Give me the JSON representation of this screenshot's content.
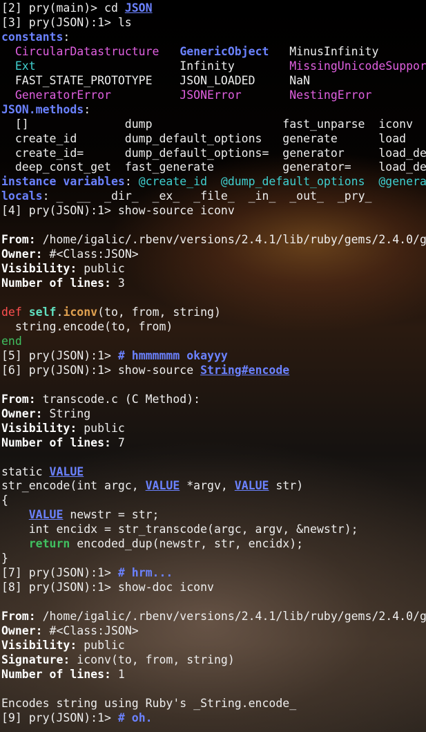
{
  "lines": [
    {
      "segs": [
        {
          "t": "[2] pry(main)> cd ",
          "cls": "c-norm"
        },
        {
          "t": "JSON",
          "cls": "c-blue-u"
        }
      ]
    },
    {
      "segs": [
        {
          "t": "[3] pry(JSON):1> ls",
          "cls": "c-norm"
        }
      ]
    },
    {
      "segs": [
        {
          "t": "constants",
          "cls": "c-blue bold"
        },
        {
          "t": ": ",
          "cls": "c-norm"
        }
      ]
    },
    {
      "segs": [
        {
          "t": "  ",
          "cls": ""
        },
        {
          "t": "CircularDatastructure",
          "cls": "c-magenta"
        },
        {
          "t": "   ",
          "cls": ""
        },
        {
          "t": "GenericObject",
          "cls": "c-blue"
        },
        {
          "t": "   MinusInfinity",
          "cls": "c-norm"
        }
      ]
    },
    {
      "segs": [
        {
          "t": "  ",
          "cls": ""
        },
        {
          "t": "Ext",
          "cls": "c-cyan"
        },
        {
          "t": "                     Infinity        ",
          "cls": "c-norm"
        },
        {
          "t": "MissingUnicodeSupport",
          "cls": "c-magenta"
        }
      ]
    },
    {
      "segs": [
        {
          "t": "  FAST_STATE_PROTOTYPE    JSON_LOADED     NaN",
          "cls": "c-norm"
        }
      ]
    },
    {
      "segs": [
        {
          "t": "  ",
          "cls": ""
        },
        {
          "t": "GeneratorError",
          "cls": "c-magenta"
        },
        {
          "t": "          ",
          "cls": ""
        },
        {
          "t": "JSONError",
          "cls": "c-magenta"
        },
        {
          "t": "       ",
          "cls": ""
        },
        {
          "t": "NestingError",
          "cls": "c-magenta"
        }
      ]
    },
    {
      "segs": [
        {
          "t": "JSON.methods",
          "cls": "c-blue bold"
        },
        {
          "t": ": ",
          "cls": "c-norm"
        }
      ]
    },
    {
      "segs": [
        {
          "t": "  []              dump                   fast_unparse  iconv",
          "cls": "c-norm"
        }
      ]
    },
    {
      "segs": [
        {
          "t": "  create_id       dump_default_options   generate      load",
          "cls": "c-norm"
        }
      ]
    },
    {
      "segs": [
        {
          "t": "  create_id=      dump_default_options=  generator     load_de",
          "cls": "c-norm"
        }
      ]
    },
    {
      "segs": [
        {
          "t": "  deep_const_get  fast_generate          generator=    load_de",
          "cls": "c-norm"
        }
      ]
    },
    {
      "segs": [
        {
          "t": "instance variables",
          "cls": "c-blue bold"
        },
        {
          "t": ": ",
          "cls": "c-norm"
        },
        {
          "t": "@create_id  @dump_default_options  @genera",
          "cls": "c-cyan"
        }
      ]
    },
    {
      "segs": [
        {
          "t": "locals",
          "cls": "c-blue bold"
        },
        {
          "t": ": _  __  _dir_  _ex_  _file_  _in_  _out_  _pry_",
          "cls": "c-norm"
        }
      ]
    },
    {
      "segs": [
        {
          "t": "[4] pry(JSON):1> show-source iconv",
          "cls": "c-norm"
        }
      ]
    },
    {
      "segs": [
        {
          "t": "",
          "cls": ""
        }
      ]
    },
    {
      "segs": [
        {
          "t": "From:",
          "cls": "c-white bold"
        },
        {
          "t": " /home/igalic/.rbenv/versions/2.4.1/lib/ruby/gems/2.4.0/g",
          "cls": "c-norm"
        }
      ]
    },
    {
      "segs": [
        {
          "t": "Owner:",
          "cls": "c-white bold"
        },
        {
          "t": " #<Class:JSON>",
          "cls": "c-norm"
        }
      ]
    },
    {
      "segs": [
        {
          "t": "Visibility:",
          "cls": "c-white bold"
        },
        {
          "t": " public",
          "cls": "c-norm"
        }
      ]
    },
    {
      "segs": [
        {
          "t": "Number of lines:",
          "cls": "c-white bold"
        },
        {
          "t": " 3",
          "cls": "c-norm"
        }
      ]
    },
    {
      "segs": [
        {
          "t": "",
          "cls": ""
        }
      ]
    },
    {
      "segs": [
        {
          "t": "def",
          "cls": "c-red"
        },
        {
          "t": " ",
          "cls": ""
        },
        {
          "t": "self",
          "cls": "c-mint"
        },
        {
          "t": ".",
          "cls": "c-norm"
        },
        {
          "t": "iconv",
          "cls": "c-orange"
        },
        {
          "t": "(to, from, string)",
          "cls": "c-norm"
        }
      ]
    },
    {
      "segs": [
        {
          "t": "  string.encode(to, from)",
          "cls": "c-norm"
        }
      ]
    },
    {
      "segs": [
        {
          "t": "end",
          "cls": "c-green"
        }
      ]
    },
    {
      "segs": [
        {
          "t": "[5] pry(JSON):1> ",
          "cls": "c-norm"
        },
        {
          "t": "# hmmmmmm okayyy",
          "cls": "c-blue bold"
        }
      ]
    },
    {
      "segs": [
        {
          "t": "[6] pry(JSON):1> show-source ",
          "cls": "c-norm"
        },
        {
          "t": "String#encode",
          "cls": "c-blue-u"
        }
      ]
    },
    {
      "segs": [
        {
          "t": "",
          "cls": ""
        }
      ]
    },
    {
      "segs": [
        {
          "t": "From:",
          "cls": "c-white bold"
        },
        {
          "t": " transcode.c (C Method):",
          "cls": "c-norm"
        }
      ]
    },
    {
      "segs": [
        {
          "t": "Owner:",
          "cls": "c-white bold"
        },
        {
          "t": " String",
          "cls": "c-norm"
        }
      ]
    },
    {
      "segs": [
        {
          "t": "Visibility:",
          "cls": "c-white bold"
        },
        {
          "t": " public",
          "cls": "c-norm"
        }
      ]
    },
    {
      "segs": [
        {
          "t": "Number of lines:",
          "cls": "c-white bold"
        },
        {
          "t": " 7",
          "cls": "c-norm"
        }
      ]
    },
    {
      "segs": [
        {
          "t": "",
          "cls": ""
        }
      ]
    },
    {
      "segs": [
        {
          "t": "static ",
          "cls": "c-norm"
        },
        {
          "t": "VALUE",
          "cls": "c-blue-u"
        }
      ]
    },
    {
      "segs": [
        {
          "t": "str_encode(int argc, ",
          "cls": "c-norm"
        },
        {
          "t": "VALUE",
          "cls": "c-blue-u"
        },
        {
          "t": " *argv, ",
          "cls": "c-norm"
        },
        {
          "t": "VALUE",
          "cls": "c-blue-u"
        },
        {
          "t": " str)",
          "cls": "c-norm"
        }
      ]
    },
    {
      "segs": [
        {
          "t": "{",
          "cls": "c-norm"
        }
      ]
    },
    {
      "segs": [
        {
          "t": "    ",
          "cls": ""
        },
        {
          "t": "VALUE",
          "cls": "c-blue-u"
        },
        {
          "t": " newstr = str;",
          "cls": "c-norm"
        }
      ]
    },
    {
      "segs": [
        {
          "t": "    int encidx = str_transcode(argc, argv, &newstr);",
          "cls": "c-norm"
        }
      ]
    },
    {
      "segs": [
        {
          "t": "    ",
          "cls": ""
        },
        {
          "t": "return",
          "cls": "c-green-b"
        },
        {
          "t": " encoded_dup(newstr, str, encidx);",
          "cls": "c-norm"
        }
      ]
    },
    {
      "segs": [
        {
          "t": "}",
          "cls": "c-norm"
        }
      ]
    },
    {
      "segs": [
        {
          "t": "[7] pry(JSON):1> ",
          "cls": "c-norm"
        },
        {
          "t": "# hrm...",
          "cls": "c-blue bold"
        }
      ]
    },
    {
      "segs": [
        {
          "t": "[8] pry(JSON):1> show-doc iconv",
          "cls": "c-norm"
        }
      ]
    },
    {
      "segs": [
        {
          "t": "",
          "cls": ""
        }
      ]
    },
    {
      "segs": [
        {
          "t": "From:",
          "cls": "c-white bold"
        },
        {
          "t": " /home/igalic/.rbenv/versions/2.4.1/lib/ruby/gems/2.4.0/g",
          "cls": "c-norm"
        }
      ]
    },
    {
      "segs": [
        {
          "t": "Owner:",
          "cls": "c-white bold"
        },
        {
          "t": " #<Class:JSON>",
          "cls": "c-norm"
        }
      ]
    },
    {
      "segs": [
        {
          "t": "Visibility:",
          "cls": "c-white bold"
        },
        {
          "t": " public",
          "cls": "c-norm"
        }
      ]
    },
    {
      "segs": [
        {
          "t": "Signature:",
          "cls": "c-white bold"
        },
        {
          "t": " iconv(to, from, string)",
          "cls": "c-norm"
        }
      ]
    },
    {
      "segs": [
        {
          "t": "Number of lines:",
          "cls": "c-white bold"
        },
        {
          "t": " 1",
          "cls": "c-norm"
        }
      ]
    },
    {
      "segs": [
        {
          "t": "",
          "cls": ""
        }
      ]
    },
    {
      "segs": [
        {
          "t": "Encodes string using Ruby's _String.encode_",
          "cls": "c-norm"
        }
      ]
    },
    {
      "segs": [
        {
          "t": "[9] pry(JSON):1> ",
          "cls": "c-norm"
        },
        {
          "t": "# oh.",
          "cls": "c-blue bold"
        }
      ]
    }
  ]
}
